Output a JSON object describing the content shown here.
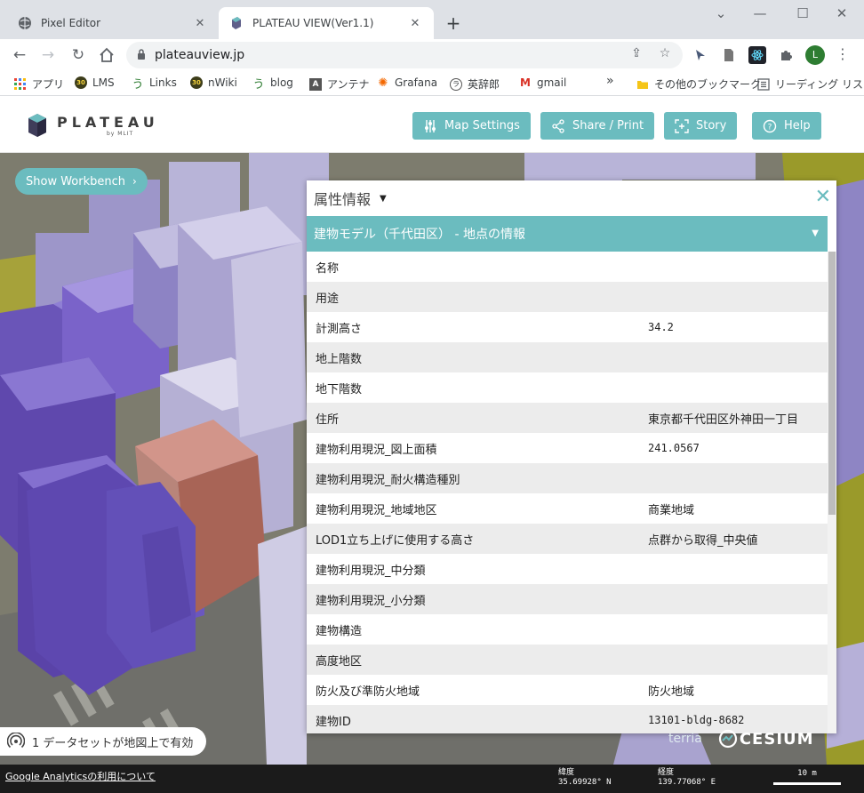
{
  "browser": {
    "tabs": [
      {
        "title": "Pixel Editor",
        "active": false
      },
      {
        "title": "PLATEAU VIEW(Ver1.1)",
        "active": true
      }
    ],
    "url": "plateauview.jp",
    "bookmarks": [
      {
        "label": "アプリ",
        "icon": "apps-grid-icon"
      },
      {
        "label": "LMS",
        "icon": "30-badge-icon"
      },
      {
        "label": "Links",
        "icon": "u-glyph-icon"
      },
      {
        "label": "nWiki",
        "icon": "30-badge-icon"
      },
      {
        "label": "blog",
        "icon": "u-glyph-icon"
      },
      {
        "label": "アンテナ",
        "icon": "a-letter-icon"
      },
      {
        "label": "Grafana",
        "icon": "grafana-icon"
      },
      {
        "label": "英辞郎",
        "icon": "eijiro-icon"
      },
      {
        "label": "gmail",
        "icon": "gmail-icon"
      },
      {
        "label": "その他のブックマーク",
        "icon": "folder-icon"
      },
      {
        "label": "リーディング リスト",
        "icon": "reading-list-icon"
      }
    ],
    "profile_initial": "L",
    "accent": "#6bbcbf"
  },
  "app": {
    "logo_name": "PLATEAU",
    "logo_sub": "by MLIT",
    "buttons": {
      "map_settings": "Map Settings",
      "share_print": "Share / Print",
      "story": "Story",
      "help": "Help"
    },
    "workbench": "Show Workbench",
    "dataset_status": "1 データセットが地図上で有効"
  },
  "panel": {
    "title": "属性情報",
    "section": "建物モデル（千代田区） - 地点の情報",
    "rows": [
      {
        "key": "名称",
        "value": ""
      },
      {
        "key": "用途",
        "value": ""
      },
      {
        "key": "計測高さ",
        "value": "34.2"
      },
      {
        "key": "地上階数",
        "value": ""
      },
      {
        "key": "地下階数",
        "value": ""
      },
      {
        "key": "住所",
        "value": "東京都千代田区外神田一丁目"
      },
      {
        "key": "建物利用現況_図上面積",
        "value": "241.0567"
      },
      {
        "key": "建物利用現況_耐火構造種別",
        "value": ""
      },
      {
        "key": "建物利用現況_地域地区",
        "value": "商業地域"
      },
      {
        "key": "LOD1立ち上げに使用する高さ",
        "value": "点群から取得_中央値"
      },
      {
        "key": "建物利用現況_中分類",
        "value": ""
      },
      {
        "key": "建物利用現況_小分類",
        "value": ""
      },
      {
        "key": "建物構造",
        "value": ""
      },
      {
        "key": "高度地区",
        "value": ""
      },
      {
        "key": "防火及び準防火地域",
        "value": "防火地域"
      },
      {
        "key": "建物ID",
        "value": "13101-bldg-8682"
      }
    ]
  },
  "footer": {
    "ga_link": "Google Analyticsの利用について",
    "lat_label": "緯度",
    "lat_value": "35.69928° N",
    "lon_label": "経度",
    "lon_value": "139.77068° E",
    "scale_label": "10 m",
    "terria": "terria",
    "cesium": "CESIUM"
  }
}
